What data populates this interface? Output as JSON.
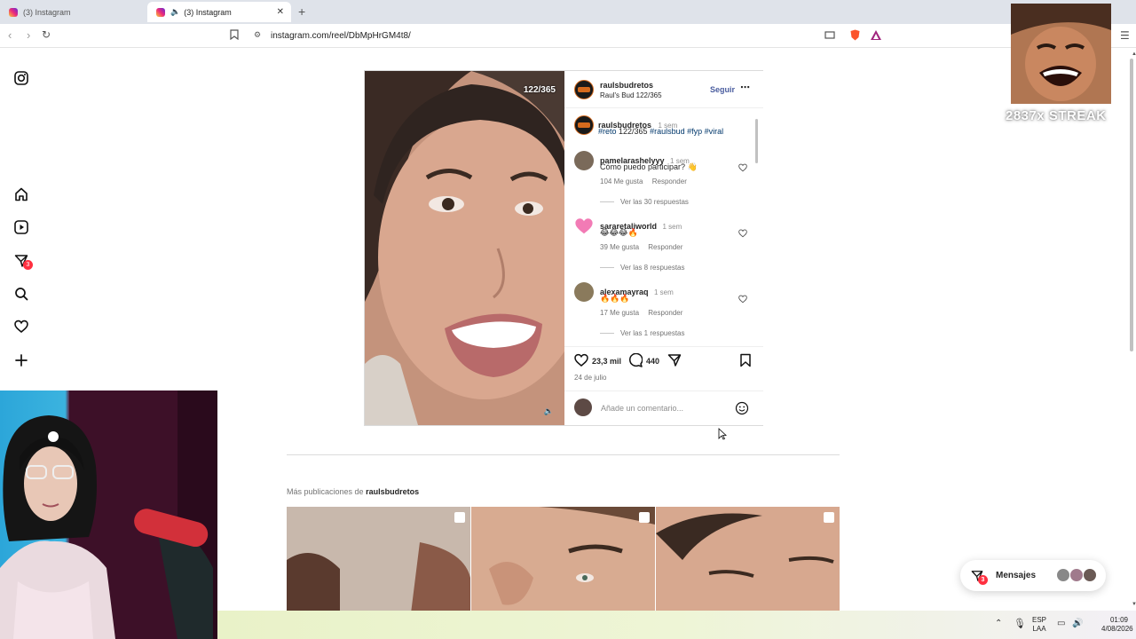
{
  "browser": {
    "tabs": [
      {
        "label": "(3) Instagram"
      },
      {
        "label": "(3) Instagram"
      }
    ],
    "url": "instagram.com/reel/DbMpHrGM4t8/"
  },
  "sidebar": {
    "badge_count": "3"
  },
  "post": {
    "counter": "122/365",
    "author": {
      "username": "raulsbudretos",
      "subtitle": "Raul's Bud 122/365",
      "follow_label": "Seguir"
    },
    "caption": {
      "username": "raulsbudretos",
      "time": "1 sem",
      "text_tags": [
        "#reto"
      ],
      "text_mid": " 122/365 ",
      "tags_after": [
        "#raulsbud",
        "#fyp",
        "#viral"
      ]
    },
    "comments": [
      {
        "username": "pamelarashelyyy",
        "time": "1 sem",
        "text": "Cómo puedo participar? 👋",
        "likes": "104 Me gusta",
        "reply": "Responder",
        "view_replies": "Ver las 30 respuestas"
      },
      {
        "username": "sararetaliworld",
        "time": "1 sem",
        "text": "😂😂😂🔥",
        "likes": "39 Me gusta",
        "reply": "Responder",
        "view_replies": "Ver las 8 respuestas"
      },
      {
        "username": "alexamayraq",
        "time": "1 sem",
        "text": "🔥🔥🔥",
        "likes": "17 Me gusta",
        "reply": "Responder",
        "view_replies": "Ver las 1 respuestas"
      }
    ],
    "likes_count": "23,3 mil",
    "comments_count": "440",
    "date": "24 de julio",
    "comment_placeholder": "Añade un comentario..."
  },
  "more": {
    "prefix": "Más publicaciones de",
    "username": "raulsbudretos"
  },
  "messages": {
    "label": "Mensajes",
    "badge": "3"
  },
  "overlay": {
    "streak": "2837x STREAK"
  },
  "taskbar": {
    "lang1": "ESP",
    "lang2": "LAA",
    "time": "01:09",
    "date": "4/08/2026"
  }
}
